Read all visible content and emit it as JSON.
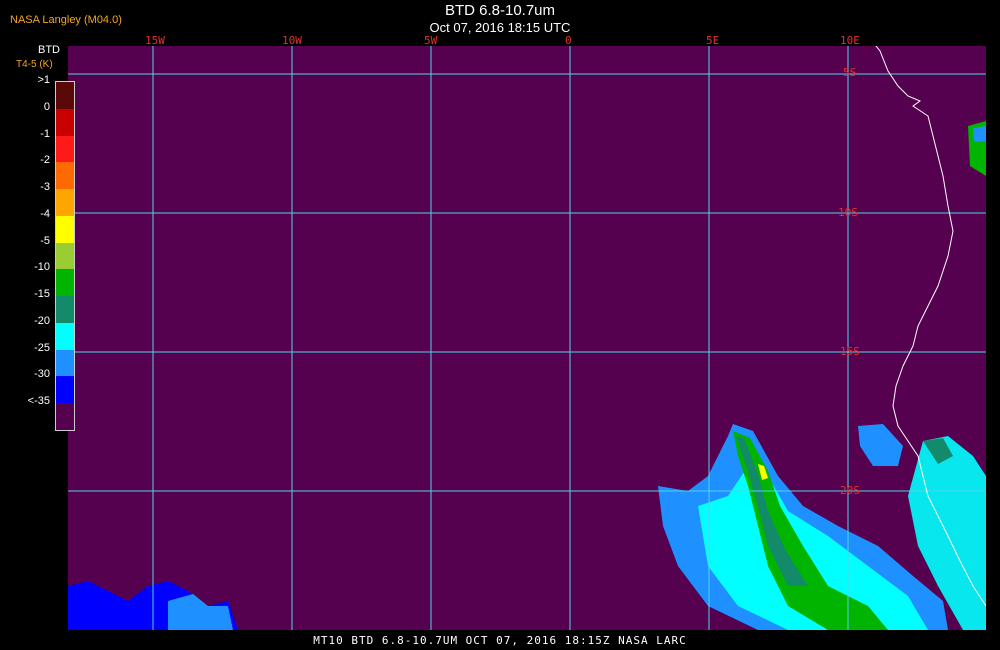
{
  "header": {
    "credit": "NASA Langley (M04.0)",
    "title": "BTD 6.8-10.7um",
    "subtitle": "Oct 07, 2016 18:15 UTC"
  },
  "legend": {
    "title": "BTD",
    "units": "T4-5 (K)",
    "entries": [
      {
        "label": ">1",
        "color": "#5a0808"
      },
      {
        "label": "0",
        "color": "#c80000"
      },
      {
        "label": "-1",
        "color": "#ff1a1a"
      },
      {
        "label": "-2",
        "color": "#ff6a00"
      },
      {
        "label": "-3",
        "color": "#ffa500"
      },
      {
        "label": "-4",
        "color": "#ffff00"
      },
      {
        "label": "-5",
        "color": "#9acd32"
      },
      {
        "label": "-10",
        "color": "#00b400"
      },
      {
        "label": "-15",
        "color": "#138a6a"
      },
      {
        "label": "-20",
        "color": "#00ffff"
      },
      {
        "label": "-25",
        "color": "#1e90ff"
      },
      {
        "label": "-30",
        "color": "#0000ff"
      },
      {
        "label": "<-35",
        "color": "#560050"
      }
    ]
  },
  "map": {
    "background_color": "#560050",
    "grid_color": "#4fd5e8",
    "coast_color": "#ffffff",
    "lon_labels": [
      "15W",
      "10W",
      "5W",
      "0",
      "5E",
      "10E"
    ],
    "lat_labels": [
      "5S",
      "10S",
      "15S",
      "20S"
    ]
  },
  "footer": {
    "text": "MT10  BTD 6.8-10.7UM   OCT 07, 2016 18:15Z   NASA LARC"
  }
}
